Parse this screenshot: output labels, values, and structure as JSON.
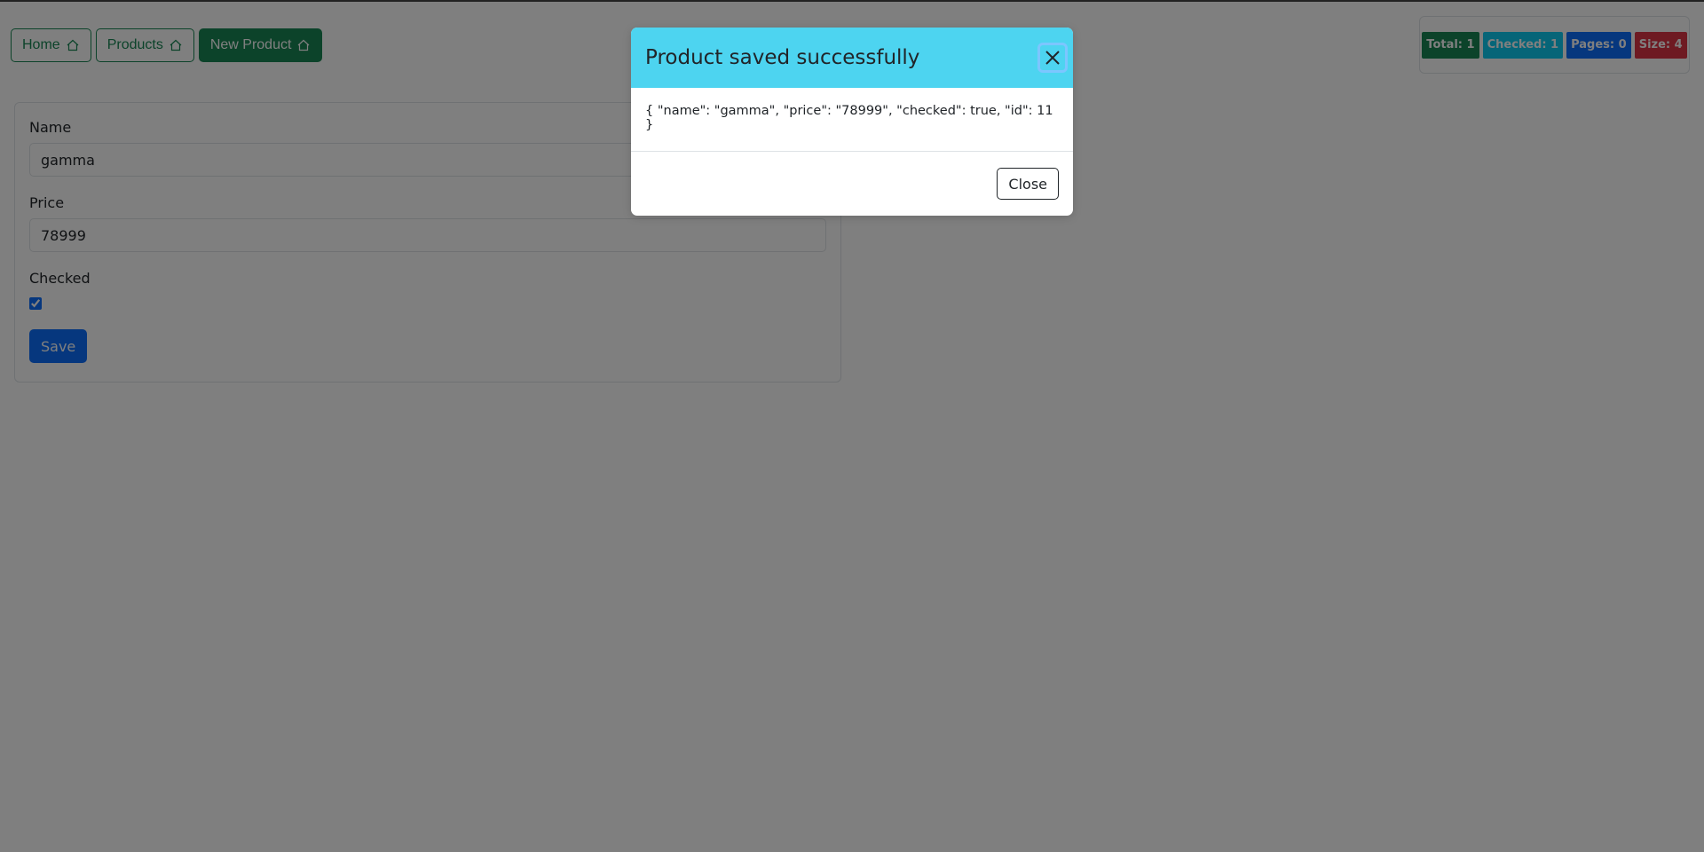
{
  "nav": {
    "items": [
      {
        "label": "Home",
        "icon": "house-icon"
      },
      {
        "label": "Products",
        "icon": "house-icon"
      },
      {
        "label": "New Product",
        "icon": "house-icon",
        "active": true
      }
    ]
  },
  "stats": {
    "total": "Total: 1",
    "checked": "Checked: 1",
    "pages": "Pages: 0",
    "size": "Size: 4",
    "colors": {
      "total": "#198754",
      "checked": "#0dcaf0",
      "pages": "#0d6efd",
      "size": "#dc3545"
    }
  },
  "form": {
    "name_label": "Name",
    "name_value": "gamma",
    "price_label": "Price",
    "price_value": "78999",
    "checked_label": "Checked",
    "checked": true,
    "save_label": "Save"
  },
  "modal": {
    "title": "Product saved successfully",
    "body": "{ \"name\": \"gamma\", \"price\": \"78999\", \"checked\": true, \"id\": 11 }",
    "close_label": "Close",
    "header_color": "#4dd4f0"
  }
}
